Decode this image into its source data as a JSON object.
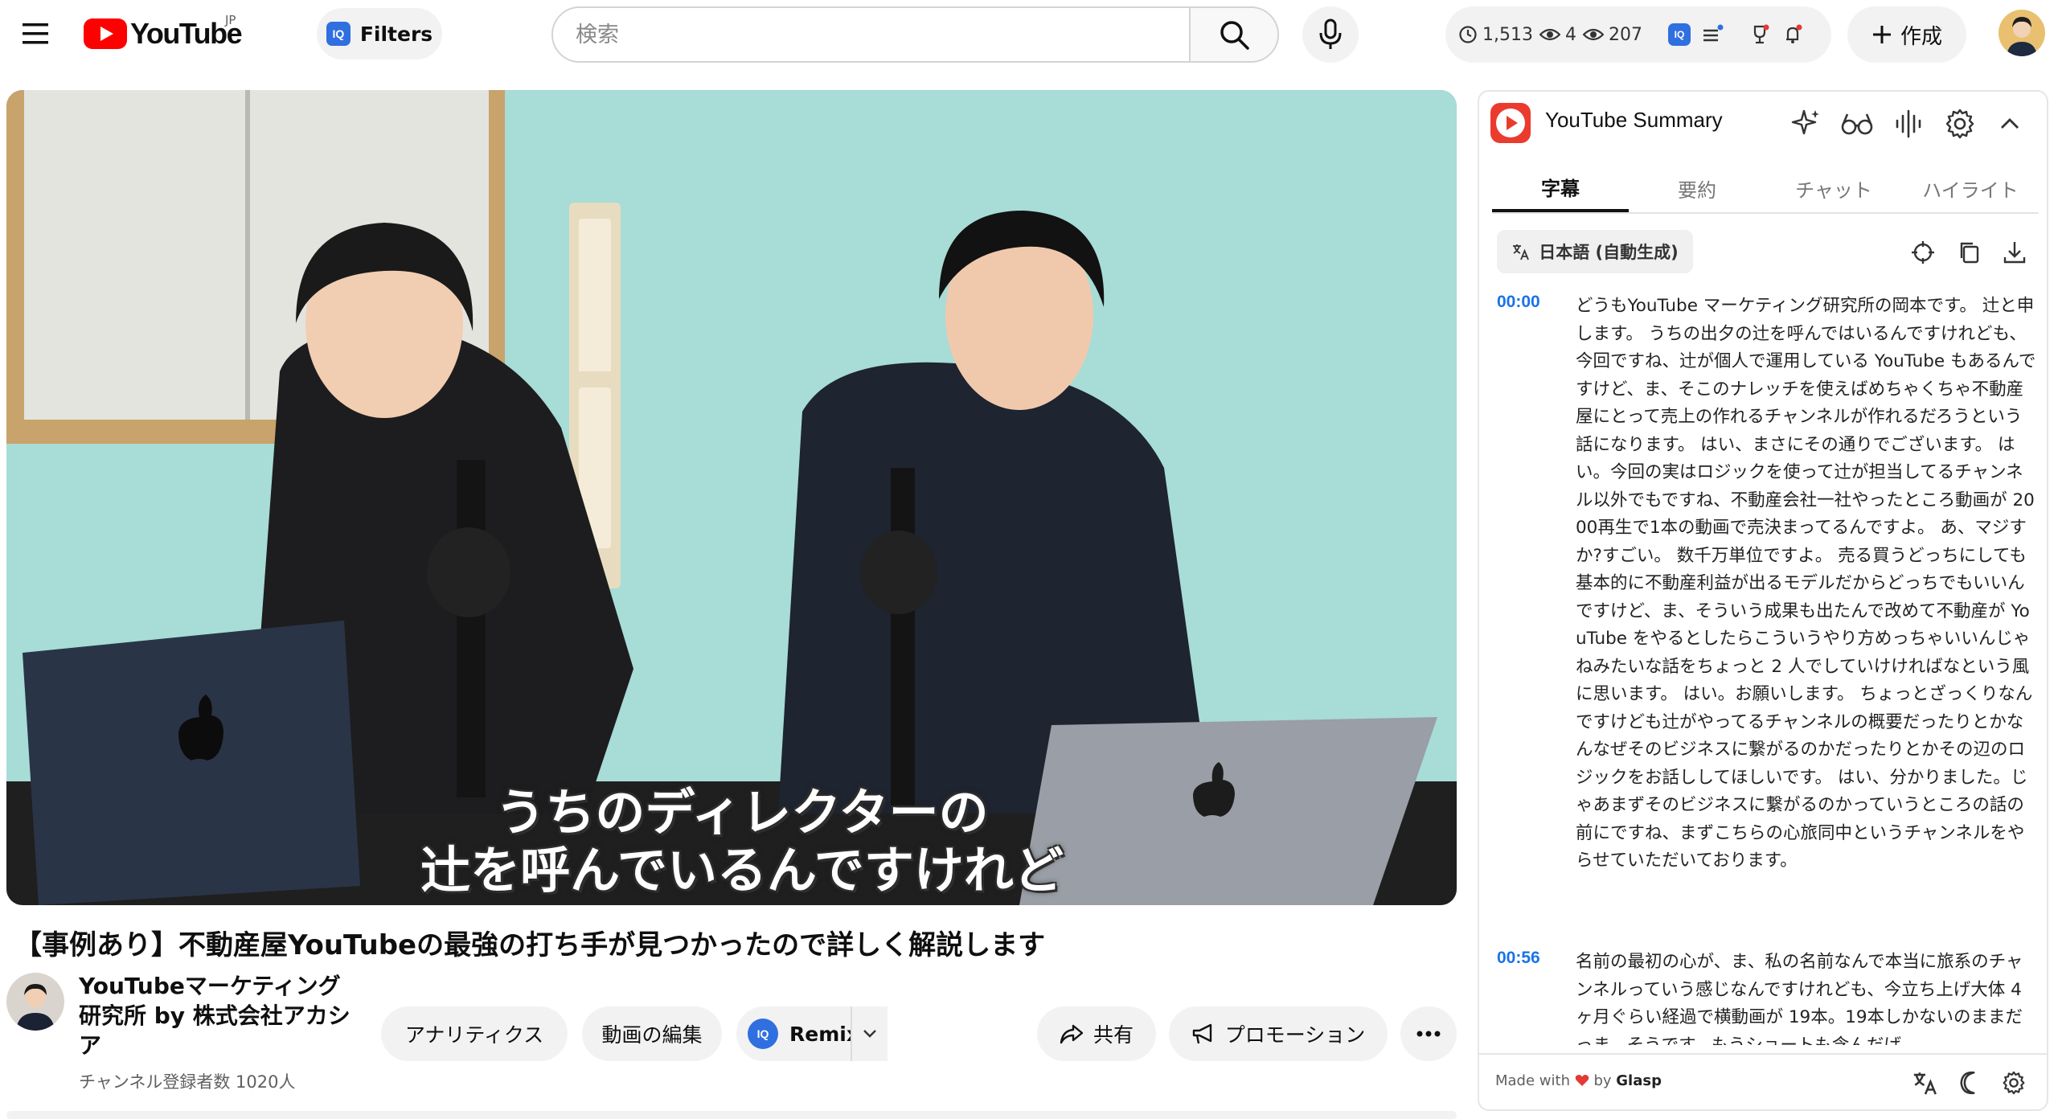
{
  "header": {
    "logo_text": "YouTube",
    "region": "JP",
    "filters_label": "Filters",
    "iq_badge": "IQ",
    "search_placeholder": "検索",
    "stats": {
      "watch_time": "1,513",
      "views_a": "4",
      "views_b": "207"
    },
    "create_label": "作成"
  },
  "video": {
    "subtitle_line1": "うちのディレクターの",
    "subtitle_line2": "辻を呼んでいるんですけれど",
    "title": "【事例あり】不動産屋YouTubeの最強の打ち手が見つかったので詳しく解説します",
    "channel_name": "YouTubeマーケティング研究所 by 株式会社アカシア",
    "subscribers": "チャンネル登録者数 1020人"
  },
  "actions": {
    "analytics": "アナリティクス",
    "edit": "動画の編集",
    "remix": "Remix",
    "share": "共有",
    "promotion": "プロモーション"
  },
  "summary_panel": {
    "title": "YouTube Summary",
    "tabs": [
      "字幕",
      "要約",
      "チャット",
      "ハイライト"
    ],
    "active_tab": "字幕",
    "language": "日本語 (自動生成)",
    "transcript": [
      {
        "time": "00:00",
        "text": "どうもYouTube マーケティング研究所の岡本です。 辻と申します。 うちの出夕の辻を呼んではいるんですけれども、今回ですね、辻が個人で運用している YouTube もあるんですけど、ま、そこのナレッチを使えばめちゃくちゃ不動産屋にとって売上の作れるチャンネルが作れるだろうという話になります。 はい、まさにその通りでございます。 はい。今回の実はロジックを使って辻が担当してるチャンネル以外でもですね、不動産会社一社やったところ動画が 2000再生で1本の動画で売決まってるんですよ。 あ、マジすか?すごい。 数千万単位ですよ。 売る買うどっちにしても基本的に不動産利益が出るモデルだからどっちでもいいんですけど、ま、そういう成果も出たんで改めて不動産が YouTube をやるとしたらこういうやり方めっちゃいいんじゃねみたいな話をちょっと 2 人でしていけければなという風に思います。 はい。お願いします。 ちょっとざっくりなんですけども辻がやってるチャンネルの概要だったりとかなんなぜそのビジネスに繋がるのかだったりとかその辺のロジックをお話ししてほしいです。 はい、分かりました。じゃあまずそのビジネスに繋がるのかっていうところの話の前にですね、まずこちらの心旅同中というチャンネルをやらせていただいております。"
      },
      {
        "time": "00:56",
        "text": "名前の最初の心が、ま、私の名前なんで本当に旅系のチャンネルっていう感じなんですけれども、今立ち上げ大体 4ヶ月ぐらい経過で横動画が 19本。19本しかないのままだっま、そうです。もうショートも含んだげ"
      }
    ],
    "footer_prefix": "Made with",
    "footer_by": "by",
    "footer_brand": "Glasp"
  },
  "colors": {
    "accent_red": "#ff0000",
    "link_blue": "#1a73e8",
    "iq_blue": "#2f6fe0"
  }
}
